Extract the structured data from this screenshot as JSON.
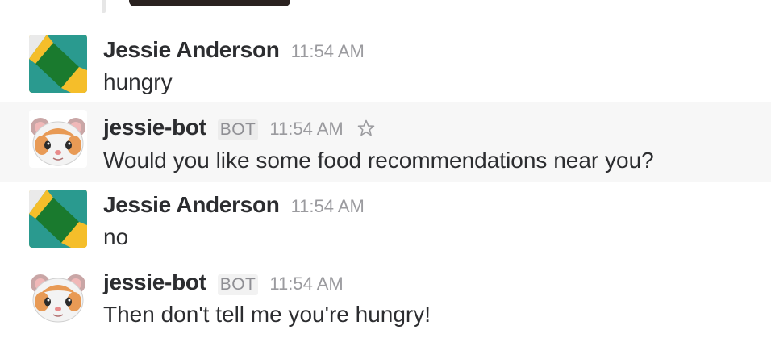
{
  "messages": [
    {
      "sender": "Jessie Anderson",
      "time": "11:54 AM",
      "text": "hungry",
      "is_bot": false
    },
    {
      "sender": "jessie-bot",
      "badge": "BOT",
      "time": "11:54 AM",
      "text": "Would you like some food recommendations near you?",
      "is_bot": true,
      "hovered": true,
      "star_icon": "star-outline-icon"
    },
    {
      "sender": "Jessie Anderson",
      "time": "11:54 AM",
      "text": "no",
      "is_bot": false
    },
    {
      "sender": "jessie-bot",
      "badge": "BOT",
      "time": "11:54 AM",
      "text": "Then don't tell me you're hungry!",
      "is_bot": true
    }
  ],
  "colors": {
    "sender_text": "#2c2d30",
    "timestamp": "#9b9b9f",
    "hover_background": "#f7f7f7",
    "avatar_green": "#1a7a2e",
    "avatar_teal": "#2a9a8f",
    "avatar_yellow": "#f5be2a"
  }
}
